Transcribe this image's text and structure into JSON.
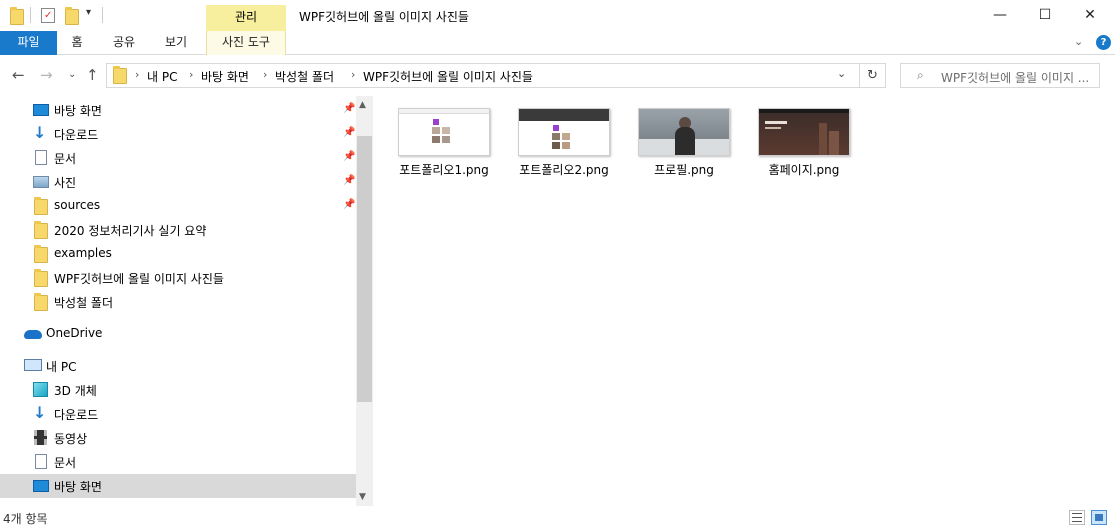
{
  "window": {
    "title": "WPF깃허브에 올릴 이미지 사진들",
    "context_tab": "관리",
    "minimize": "—",
    "maximize": "☐",
    "close": "✕"
  },
  "ribbon": {
    "tabs": [
      "파일",
      "홈",
      "공유",
      "보기",
      "사진 도구"
    ],
    "help": "?"
  },
  "address": {
    "crumbs": [
      "내 PC",
      "바탕 화면",
      "박성철 폴더",
      "WPF깃허브에 올릴 이미지 사진들"
    ],
    "search_placeholder": "WPF깃허브에 올릴 이미지 ..."
  },
  "nav": {
    "quick_access": [
      {
        "label": "바탕 화면",
        "icon": "desktop-icon",
        "pinned": true
      },
      {
        "label": "다운로드",
        "icon": "download-icon",
        "pinned": true
      },
      {
        "label": "문서",
        "icon": "document-icon",
        "pinned": true
      },
      {
        "label": "사진",
        "icon": "pictures-icon",
        "pinned": true
      },
      {
        "label": "sources",
        "icon": "folder-icon",
        "pinned": true
      },
      {
        "label": "2020 정보처리기사 실기 요약",
        "icon": "folder-icon",
        "pinned": false
      },
      {
        "label": "examples",
        "icon": "folder-icon",
        "pinned": false
      },
      {
        "label": "WPF깃허브에 올릴 이미지 사진들",
        "icon": "folder-icon",
        "pinned": false
      },
      {
        "label": "박성철 폴더",
        "icon": "folder-icon",
        "pinned": false
      }
    ],
    "onedrive": "OneDrive",
    "this_pc": "내 PC",
    "pc_items": [
      {
        "label": "3D 개체",
        "icon": "3d-objects-icon"
      },
      {
        "label": "다운로드",
        "icon": "download-icon"
      },
      {
        "label": "동영상",
        "icon": "video-icon"
      },
      {
        "label": "문서",
        "icon": "document-icon"
      },
      {
        "label": "바탕 화면",
        "icon": "desktop-icon"
      }
    ]
  },
  "files": [
    {
      "name": "포트폴리오1.png",
      "thumb": "portfolio-light"
    },
    {
      "name": "포트폴리오2.png",
      "thumb": "portfolio-dark"
    },
    {
      "name": "프로필.png",
      "thumb": "profile-photo"
    },
    {
      "name": "홈페이지.png",
      "thumb": "homepage-city"
    }
  ],
  "status": {
    "count": "4개 항목"
  },
  "colors": {
    "accent": "#1979ca",
    "context_tab": "#f8ef9e",
    "folder": "#f7d86b"
  }
}
